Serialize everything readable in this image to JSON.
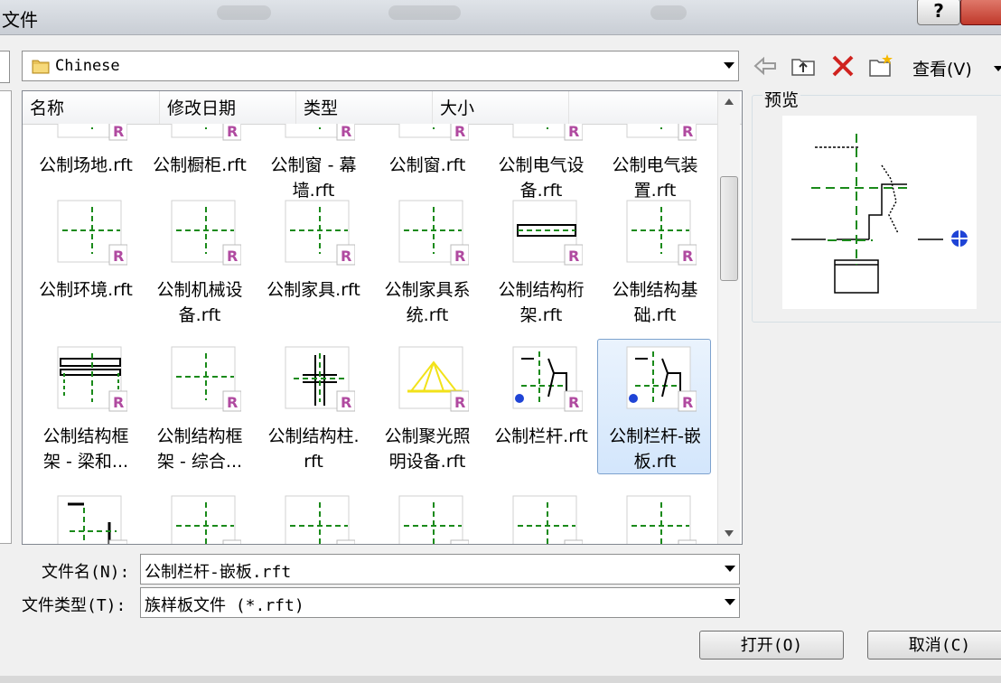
{
  "window": {
    "title": "文件"
  },
  "look_in": {
    "value": "Chinese"
  },
  "toolbar": {
    "view_label": "查看(V)"
  },
  "columns": [
    "名称",
    "修改日期",
    "类型",
    "大小"
  ],
  "files": [
    {
      "label": "公制场地.rft",
      "icon": "template-thumb"
    },
    {
      "label": "公制橱柜.rft",
      "icon": "template-thumb"
    },
    {
      "label": "公制窗 - 幕\n墙.rft",
      "icon": "template-thumb"
    },
    {
      "label": "公制窗.rft",
      "icon": "template-thumb"
    },
    {
      "label": "公制电气设\n备.rft",
      "icon": "template-thumb"
    },
    {
      "label": "公制电气装\n置.rft",
      "icon": "template-thumb"
    },
    {
      "label": "公制环境.rft",
      "icon": "template-thumb"
    },
    {
      "label": "公制机械设\n备.rft",
      "icon": "template-thumb"
    },
    {
      "label": "公制家具.rft",
      "icon": "template-thumb"
    },
    {
      "label": "公制家具系\n统.rft",
      "icon": "template-thumb"
    },
    {
      "label": "公制结构桁\n架.rft",
      "icon": "truss-thumb"
    },
    {
      "label": "公制结构基\n础.rft",
      "icon": "template-thumb"
    },
    {
      "label": "公制结构框\n架 - 梁和...",
      "icon": "frame-thumb"
    },
    {
      "label": "公制结构框\n架 - 综合...",
      "icon": "template-thumb"
    },
    {
      "label": "公制结构柱.\nrft",
      "icon": "column-thumb"
    },
    {
      "label": "公制聚光照\n明设备.rft",
      "icon": "spotlight-thumb"
    },
    {
      "label": "公制栏杆.rft",
      "icon": "railing-thumb"
    },
    {
      "label": "公制栏杆-嵌\n板.rft",
      "icon": "railing-thumb",
      "selected": true
    },
    {
      "label": "",
      "icon": "detail-thumb"
    },
    {
      "label": "",
      "icon": "template-thumb"
    },
    {
      "label": "",
      "icon": "template-thumb"
    },
    {
      "label": "",
      "icon": "template-thumb"
    },
    {
      "label": "",
      "icon": "template-thumb"
    },
    {
      "label": "",
      "icon": "template-thumb"
    }
  ],
  "preview": {
    "label": "预览"
  },
  "filename": {
    "label": "文件名(N):",
    "value": "公制栏杆-嵌板.rft"
  },
  "filetype": {
    "label": "文件类型(T):",
    "value": "族样板文件 (*.rft)"
  },
  "buttons": {
    "open": "打开(O)",
    "cancel": "取消(C)"
  }
}
